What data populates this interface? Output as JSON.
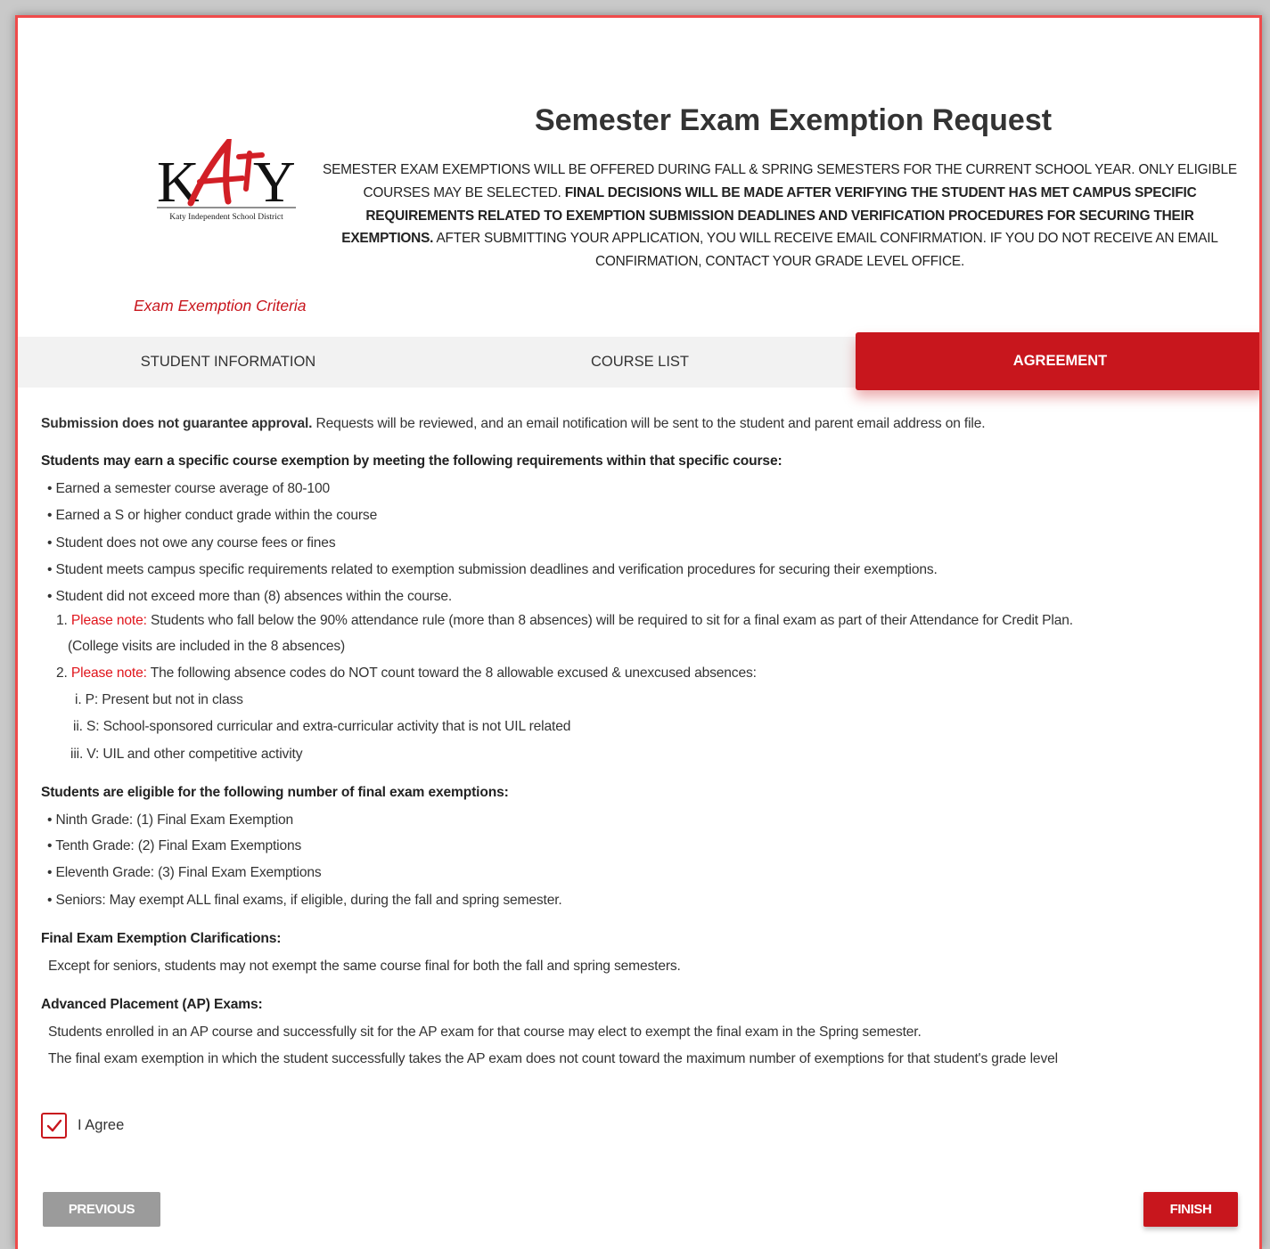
{
  "header": {
    "title": "Semester Exam Exemption Request",
    "logo": {
      "text": "KATY",
      "subtitle": "Katy Independent School District"
    },
    "intro": {
      "part1": "SEMESTER EXAM EXEMPTIONS WILL BE OFFERED DURING FALL & SPRING SEMESTERS FOR THE CURRENT SCHOOL YEAR. ONLY ELIGIBLE COURSES MAY BE SELECTED. ",
      "bold": "FINAL DECISIONS WILL BE MADE AFTER VERIFYING THE STUDENT HAS MET CAMPUS SPECIFIC REQUIREMENTS RELATED TO EXEMPTION SUBMISSION DEADLINES AND VERIFICATION PROCEDURES FOR SECURING THEIR EXEMPTIONS.",
      "part2": " AFTER SUBMITTING YOUR APPLICATION, YOU WILL RECEIVE EMAIL CONFIRMATION. IF YOU DO NOT RECEIVE AN EMAIL CONFIRMATION, CONTACT YOUR GRADE LEVEL OFFICE."
    },
    "criteria_link": "Exam Exemption Criteria"
  },
  "tabs": [
    {
      "label": "STUDENT INFORMATION",
      "active": false
    },
    {
      "label": "COURSE LIST",
      "active": false
    },
    {
      "label": "AGREEMENT",
      "active": true
    }
  ],
  "agreement": {
    "disclaimer_bold": "Submission does not guarantee approval.",
    "disclaimer_text": " Requests will be reviewed, and an email notification will be sent to the student and parent email address on file.",
    "requirements_heading": "Students may earn a specific course exemption by meeting the following requirements within that specific course:",
    "requirements": [
      "• Earned a semester course average of 80-100",
      "• Earned a S or higher conduct grade within the course",
      "• Student does not owe any course fees or fines",
      "• Student meets campus specific requirements related to exemption submission deadlines and verification procedures for securing their exemptions.",
      "• Student did not exceed more than (8) absences within the course."
    ],
    "note1_num": "1. ",
    "note1_label": "Please note:",
    "note1_text": " Students who fall below the 90% attendance rule (more than 8 absences) will be required to sit for a final exam as part of their Attendance for Credit Plan.",
    "note1_cont": "(College visits are included in the 8 absences)",
    "note2_num": "2. ",
    "note2_label": "Please note:",
    "note2_text": " The following absence codes do NOT count toward the 8 allowable excused & unexcused absences:",
    "codes": [
      "i. P: Present but not in class",
      "ii. S: School-sponsored curricular and extra-curricular activity that is not UIL related",
      "iii. V: UIL and other competitive activity"
    ],
    "eligibility_heading": "Students are eligible for the following number of final exam exemptions:",
    "eligibility": [
      "• Ninth Grade: (1) Final Exam Exemption",
      "• Tenth Grade: (2) Final Exam Exemptions",
      "• Eleventh Grade: (3) Final Exam Exemptions",
      "• Seniors: May exempt ALL final exams, if eligible, during the fall and spring semester."
    ],
    "clarifications_heading": "Final Exam Exemption Clarifications:",
    "clarifications_text": "Except for seniors, students may not exempt the same course final for both the fall and spring semesters.",
    "ap_heading": "Advanced Placement (AP) Exams:",
    "ap_text1": "Students enrolled in an AP course and successfully sit for the AP exam for that course may elect to exempt the final exam in the Spring semester.",
    "ap_text2": "The final exam exemption in which the student successfully takes the AP exam does not count toward the maximum number of exemptions for that student's grade level"
  },
  "agree": {
    "label": "I Agree",
    "checked": true
  },
  "buttons": {
    "previous": "PREVIOUS",
    "finish": "FINISH"
  },
  "colors": {
    "accent": "#c8161d",
    "note_red": "#e0141b",
    "disabled_button": "#9b9b9b",
    "tab_bar": "#f2f2f2"
  }
}
